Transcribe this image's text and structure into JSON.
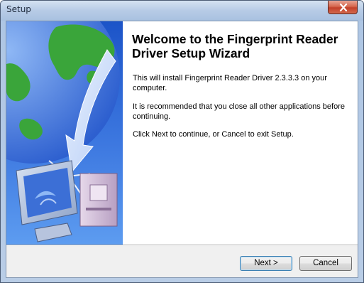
{
  "window": {
    "title": "Setup"
  },
  "wizard": {
    "heading": "Welcome to the Fingerprint Reader Driver Setup Wizard",
    "paragraphs": [
      "This will install Fingerprint Reader Driver 2.3.3.3 on your computer.",
      "It is recommended that you close all other applications before continuing.",
      "Click Next to continue, or Cancel to exit Setup."
    ]
  },
  "buttons": {
    "next_label": "Next >",
    "cancel_label": "Cancel"
  },
  "icons": {
    "close": "close-icon",
    "side_graphic": "globe-computer-install-graphic"
  },
  "colors": {
    "side_panel_blue": "#3d6fd8",
    "globe_green": "#3aa53a",
    "default_button_border": "#3c7fb1"
  }
}
